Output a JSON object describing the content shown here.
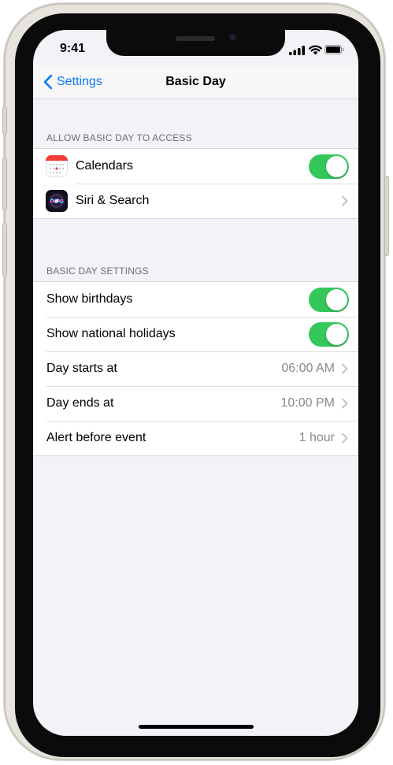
{
  "status_bar": {
    "time": "9:41"
  },
  "nav": {
    "back_label": "Settings",
    "title": "Basic Day"
  },
  "sections": [
    {
      "header": "ALLOW BASIC DAY TO ACCESS",
      "rows": [
        {
          "label": "Calendars",
          "icon": "calendar-icon",
          "control": "toggle",
          "on": true
        },
        {
          "label": "Siri & Search",
          "icon": "siri-icon",
          "control": "chevron"
        }
      ]
    },
    {
      "header": "BASIC DAY SETTINGS",
      "rows": [
        {
          "label": "Show birthdays",
          "control": "toggle",
          "on": true
        },
        {
          "label": "Show national holidays",
          "control": "toggle",
          "on": true
        },
        {
          "label": "Day starts at",
          "value": "06:00 AM",
          "control": "chevron"
        },
        {
          "label": "Day ends at",
          "value": "10:00 PM",
          "control": "chevron"
        },
        {
          "label": "Alert before event",
          "value": "1 hour",
          "control": "chevron"
        }
      ]
    }
  ],
  "colors": {
    "accent": "#0a7aff",
    "toggle_on": "#34c759",
    "background": "#f2f2f7"
  }
}
